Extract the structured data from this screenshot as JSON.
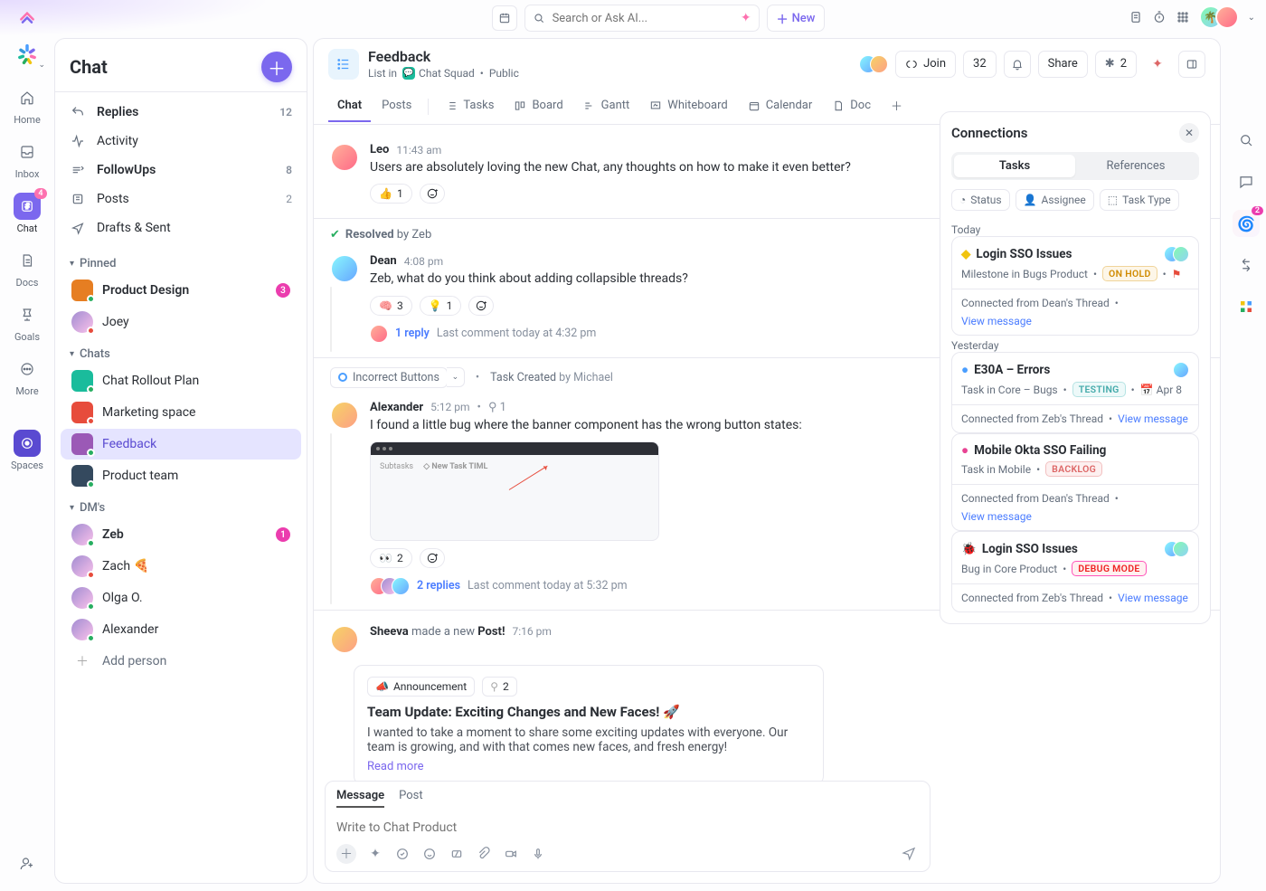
{
  "top": {
    "search_placeholder": "Search or Ask AI...",
    "new_button": "New"
  },
  "rail": [
    {
      "key": "home",
      "label": "Home"
    },
    {
      "key": "inbox",
      "label": "Inbox"
    },
    {
      "key": "chat",
      "label": "Chat",
      "active": true,
      "badge": "4"
    },
    {
      "key": "docs",
      "label": "Docs"
    },
    {
      "key": "goals",
      "label": "Goals"
    },
    {
      "key": "more",
      "label": "More"
    }
  ],
  "rail_spaces_label": "Spaces",
  "chat_panel_title": "Chat",
  "chat_nav": [
    {
      "key": "replies",
      "label": "Replies",
      "count": "12",
      "bold": true,
      "icon": "reply"
    },
    {
      "key": "activity",
      "label": "Activity",
      "icon": "activity"
    },
    {
      "key": "followups",
      "label": "FollowUps",
      "count": "8",
      "bold": true,
      "icon": "followup"
    },
    {
      "key": "posts",
      "label": "Posts",
      "count": "2",
      "icon": "posts"
    },
    {
      "key": "drafts",
      "label": "Drafts & Sent",
      "icon": "send"
    }
  ],
  "sections": {
    "pinned": {
      "label": "Pinned",
      "items": [
        {
          "label": "Product Design",
          "badge": "3",
          "bold": true,
          "color": "#e67e22"
        },
        {
          "label": "Joey",
          "round": true
        }
      ]
    },
    "chats": {
      "label": "Chats",
      "items": [
        {
          "label": "Chat Rollout Plan",
          "color": "#1abc9c"
        },
        {
          "label": "Marketing space",
          "color": "#e74c3c"
        },
        {
          "label": "Feedback",
          "color": "#9b59b6",
          "selected": true
        },
        {
          "label": "Product team",
          "color": "#34495e"
        }
      ]
    },
    "dms": {
      "label": "DM's",
      "items": [
        {
          "label": "Zeb",
          "bold": true,
          "badge": "1"
        },
        {
          "label": "Zach 🍕"
        },
        {
          "label": "Olga O."
        },
        {
          "label": "Alexander"
        }
      ]
    },
    "add_person": "Add person"
  },
  "header": {
    "title": "Feedback",
    "breadcrumb_prefix": "List in",
    "squad": "Chat Squad",
    "visibility": "Public",
    "join": "Join",
    "count": "32",
    "share": "Share",
    "ai_count": "2"
  },
  "views": [
    "Chat",
    "Posts",
    "Tasks",
    "Board",
    "Gantt",
    "Whiteboard",
    "Calendar",
    "Doc"
  ],
  "active_view": "Chat",
  "messages": [
    {
      "type": "msg",
      "author": "Leo",
      "time": "11:43 am",
      "text": "Users are absolutely loving the new Chat, any thoughts on how to make it even better?",
      "reactions": [
        {
          "e": "👍",
          "c": "1"
        }
      ]
    },
    {
      "type": "resolved",
      "by": "Zeb",
      "label": "Resolved"
    },
    {
      "type": "msg",
      "author": "Dean",
      "time": "4:08 pm",
      "text": "Zeb, what do you think about adding collapsible threads?",
      "reactions": [
        {
          "e": "🧠",
          "c": "3"
        },
        {
          "e": "💡",
          "c": "1"
        }
      ],
      "thread": {
        "replies": "1 reply",
        "last": "Last comment today at 4:32 pm",
        "avatars": 1
      }
    },
    {
      "type": "taskchip",
      "label": "Incorrect Buttons",
      "created_label": "Task Created",
      "by": "Michael"
    },
    {
      "type": "msg",
      "author": "Alexander",
      "time": "5:12 pm",
      "pinmeta": "1",
      "text": "I found a little bug where the banner component has the wrong button states:",
      "attachment": true,
      "reactions": [
        {
          "e": "👀",
          "c": "2"
        }
      ],
      "thread": {
        "replies": "2 replies",
        "last": "Last comment today at 5:32 pm",
        "avatars": 3
      }
    },
    {
      "type": "post",
      "author": "Sheeva",
      "verb": "made a new",
      "noun": "Post!",
      "time": "7:16 pm",
      "tag": "Announcement",
      "tag_count": "2",
      "title": "Team Update: Exciting Changes and New Faces! 🚀",
      "body": "I wanted to take a moment to share some exciting updates with everyone. Our team is growing, and with that comes new faces, and fresh energy!",
      "readmore": "Read more"
    }
  ],
  "composer": {
    "tabs": [
      "Message",
      "Post"
    ],
    "placeholder": "Write to Chat Product"
  },
  "connections": {
    "title": "Connections",
    "tabs": [
      "Tasks",
      "References"
    ],
    "filters": [
      "Status",
      "Assignee",
      "Task Type"
    ],
    "groups": [
      {
        "label": "Today",
        "items": [
          {
            "icon": "◆",
            "icon_color": "#f1c40f",
            "title": "Login SSO Issues",
            "sub": "Milestone in Bugs Product",
            "pill": "ON HOLD",
            "pill_class": "pill-onhold",
            "flag": true,
            "avatars": 2,
            "foot_from": "Connected from Dean's Thread",
            "foot_link": "View message"
          }
        ]
      },
      {
        "label": "Yesterday",
        "items": [
          {
            "icon": "●",
            "icon_color": "#4a9eff",
            "title": "E30A – Errors",
            "sub": "Task in Core – Bugs",
            "pill": "TESTING",
            "pill_class": "pill-testing",
            "date": "Apr 8",
            "avatars": 1,
            "foot_from": "Connected from Zeb's Thread",
            "foot_link": "View message"
          },
          {
            "icon": "●",
            "icon_color": "#e84393",
            "title": "Mobile Okta SSO Failing",
            "sub": "Task in Mobile",
            "pill": "BACKLOG",
            "pill_class": "pill-backlog",
            "foot_from": "Connected from Dean's Thread",
            "foot_link": "View message"
          },
          {
            "icon": "🐞",
            "icon_color": "#e74c3c",
            "title": "Login SSO Issues",
            "sub": "Bug in Core Product",
            "pill": "DEBUG MODE",
            "pill_class": "pill-debug",
            "avatars": 2,
            "foot_from": "Connected from Zeb's Thread",
            "foot_link": "View message"
          }
        ]
      }
    ]
  },
  "right_rail_badge": "2"
}
